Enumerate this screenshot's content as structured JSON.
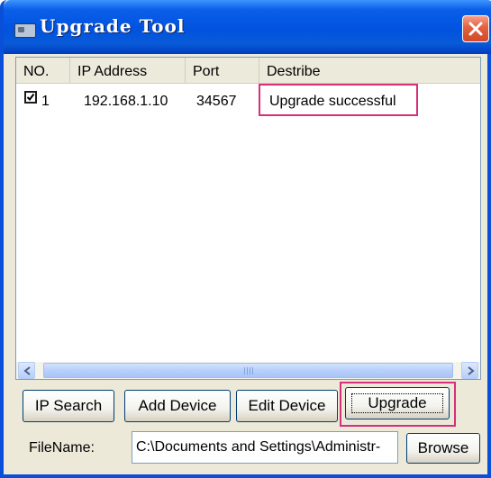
{
  "window": {
    "title": "Upgrade Tool",
    "close_label": "×"
  },
  "table": {
    "columns": [
      "NO.",
      "IP Address",
      "Port",
      "Destribe"
    ],
    "rows": [
      {
        "no": "1",
        "checked": true,
        "ip": "192.168.1.10",
        "port": "34567",
        "describe": "Upgrade successful"
      }
    ]
  },
  "scrollbar": {
    "thumb_grip": "III"
  },
  "buttons": {
    "ip_search": "IP Search",
    "add_device": "Add Device",
    "edit_device": "Edit Device",
    "upgrade": "Upgrade",
    "browse": "Browse"
  },
  "file": {
    "label": "FileName:",
    "value": "C:\\Documents and Settings\\Administr‑"
  },
  "colors": {
    "titlebar": "#0052df",
    "highlight": "#d5307a",
    "window_bg": "#ece9d8"
  }
}
